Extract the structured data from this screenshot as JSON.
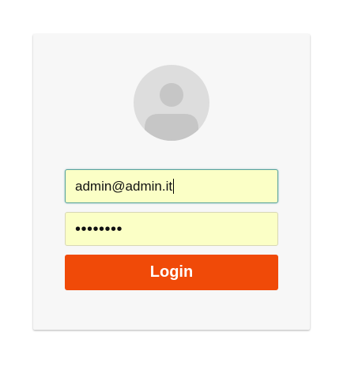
{
  "login_form": {
    "avatar_icon": "user-avatar-icon",
    "email_value": "admin@admin.it",
    "password_value": "••••••••",
    "login_label": "Login"
  },
  "colors": {
    "card_background": "#f7f7f7",
    "avatar_background": "#dddddd",
    "avatar_figure": "#c6c6c6",
    "input_background": "#fbffc6",
    "focused_border": "#58a39d",
    "button_background": "#f04a08",
    "button_text": "#ffffff"
  }
}
